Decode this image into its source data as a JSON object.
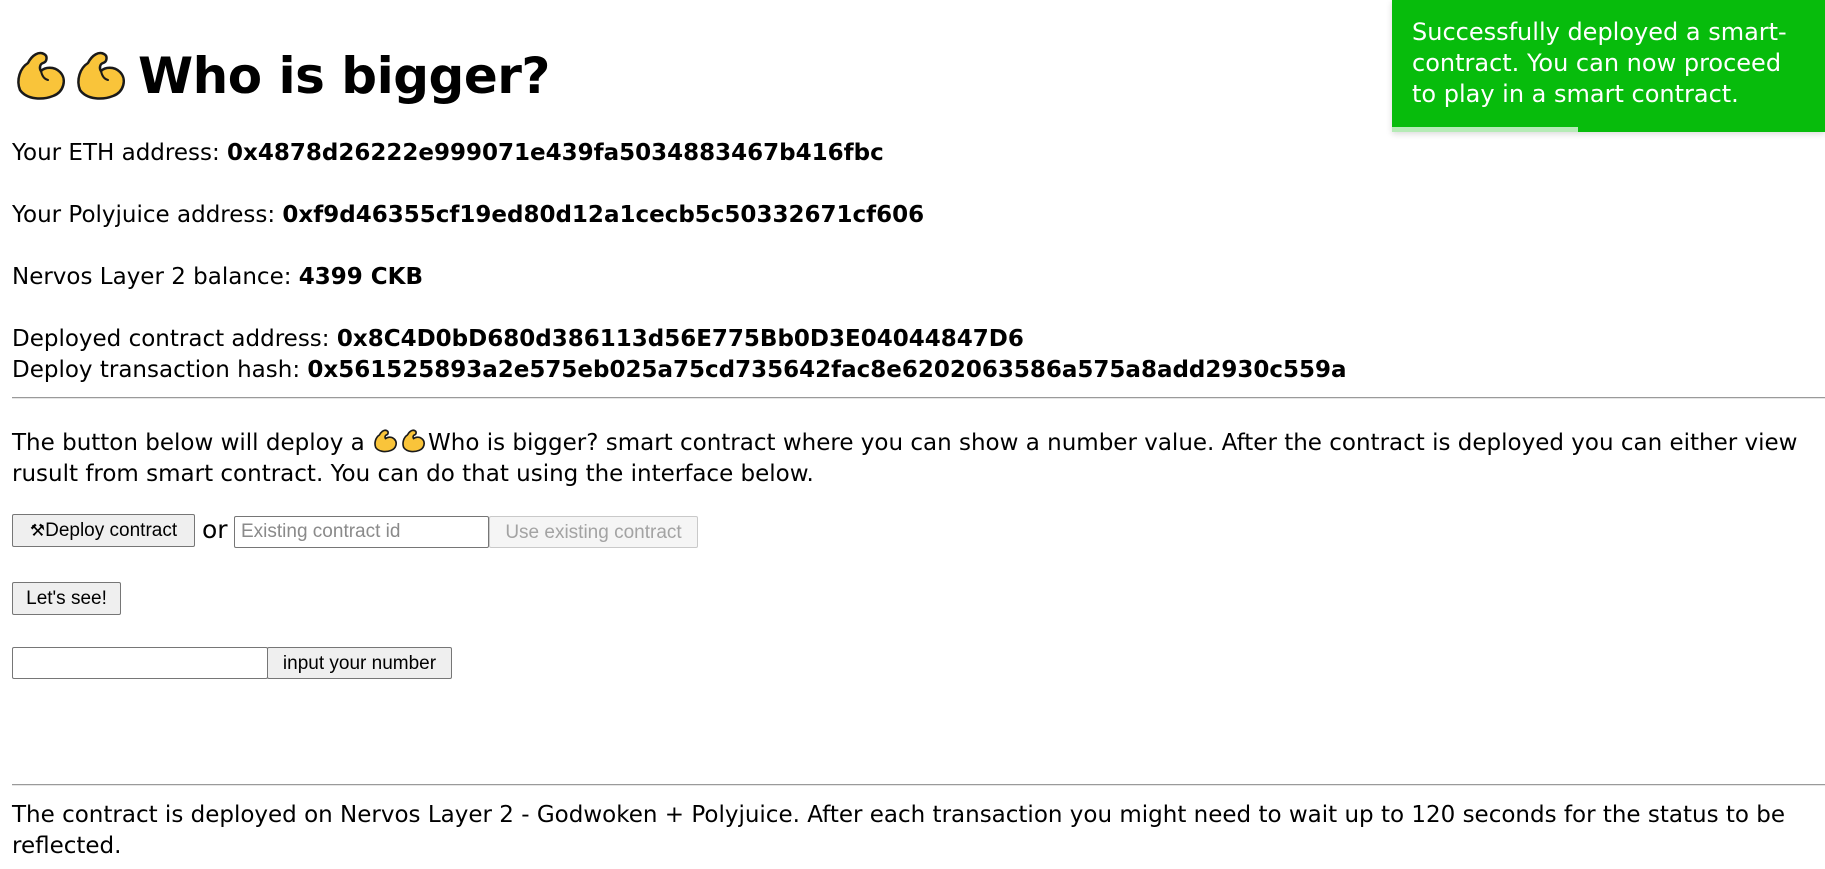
{
  "header": {
    "icon": "flexed-biceps-icon",
    "title": "Who is bigger?"
  },
  "account": {
    "eth_label": "Your ETH address: ",
    "eth_value": "0x4878d26222e999071e439fa5034883467b416fbc",
    "polyjuice_label": "Your Polyjuice address: ",
    "polyjuice_value": "0xf9d46355cf19ed80d12a1cecb5c50332671cf606",
    "balance_label": "Nervos Layer 2 balance: ",
    "balance_value": "4399 CKB",
    "contract_label": "Deployed contract address: ",
    "contract_value": "0x8C4D0bD680d386113d56E775Bb0D3E04044847D6",
    "txhash_label": "Deploy transaction hash: ",
    "txhash_value": "0x561525893a2e575eb025a75cd735642fac8e6202063586a575a8add2930c559a"
  },
  "description": {
    "prefix": "The button below will deploy a ",
    "suffix": "Who is bigger? smart contract where you can show a number value. After the contract is deployed you can either view rusult from smart contract. You can do that using the interface below."
  },
  "controls": {
    "deploy_icon": "hammer-and-wrench-icon",
    "deploy_icon_glyph": "⚒",
    "deploy_label": "Deploy contract",
    "or_text": "or",
    "existing_placeholder": "Existing contract id",
    "existing_value": "",
    "use_existing_label": "Use existing contract",
    "lets_see_label": "Let's see!",
    "number_value": "",
    "input_number_label": "input your number"
  },
  "footer": {
    "note": "The contract is deployed on Nervos Layer 2 - Godwoken + Polyjuice. After each transaction you might need to wait up to 120 seconds for the status to be reflected."
  },
  "toast": {
    "message": "Successfully deployed a smart-contract. You can now proceed to play in a smart contract.",
    "color": "#07bc0c",
    "progress_remaining": 0.43
  }
}
